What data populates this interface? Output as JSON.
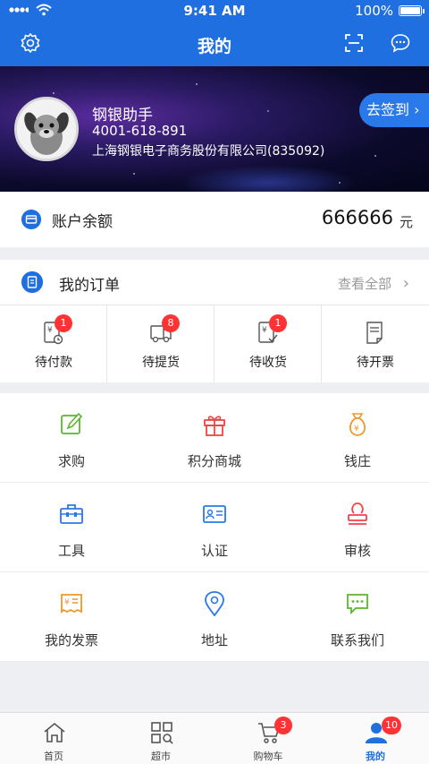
{
  "status": {
    "time": "9:41 AM",
    "battery": "100%"
  },
  "nav": {
    "title": "我的",
    "left_icon": "gear-icon",
    "right_icons": [
      "scan-icon",
      "message-icon"
    ]
  },
  "profile": {
    "name": "钢银助手",
    "phone": "4001-618-891",
    "company": "上海钢银电子商务股份有限公司(835092)",
    "checkin": "去签到"
  },
  "balance": {
    "label": "账户余额",
    "amount": "666666",
    "unit": "元"
  },
  "orders": {
    "title": "我的订单",
    "view_all": "查看全部",
    "items": [
      {
        "label": "待付款",
        "badge": "1",
        "icon": "wallet-yen-icon"
      },
      {
        "label": "待提货",
        "badge": "8",
        "icon": "truck-icon"
      },
      {
        "label": "待收货",
        "badge": "1",
        "icon": "receipt-check-icon"
      },
      {
        "label": "待开票",
        "badge": "",
        "icon": "invoice-icon"
      }
    ]
  },
  "services": [
    {
      "label": "求购",
      "icon": "edit-icon",
      "color": "#5cb531"
    },
    {
      "label": "积分商城",
      "icon": "gift-icon",
      "color": "#f04545"
    },
    {
      "label": "钱庄",
      "icon": "money-bag-icon",
      "color": "#f0972b"
    },
    {
      "label": "工具",
      "icon": "toolbox-icon",
      "color": "#2a79ea"
    },
    {
      "label": "认证",
      "icon": "id-card-icon",
      "color": "#2a79ea"
    },
    {
      "label": "审核",
      "icon": "stamp-icon",
      "color": "#f04545"
    },
    {
      "label": "我的发票",
      "icon": "invoice-yen-icon",
      "color": "#f0972b"
    },
    {
      "label": "地址",
      "icon": "location-pin-icon",
      "color": "#2a79ea"
    },
    {
      "label": "联系我们",
      "icon": "chat-icon",
      "color": "#5cb531"
    }
  ],
  "tabs": [
    {
      "label": "首页",
      "icon": "home-icon",
      "badge": ""
    },
    {
      "label": "超市",
      "icon": "market-icon",
      "badge": ""
    },
    {
      "label": "购物车",
      "icon": "cart-icon",
      "badge": "3"
    },
    {
      "label": "我的",
      "icon": "user-icon",
      "badge": "10",
      "active": true
    }
  ]
}
